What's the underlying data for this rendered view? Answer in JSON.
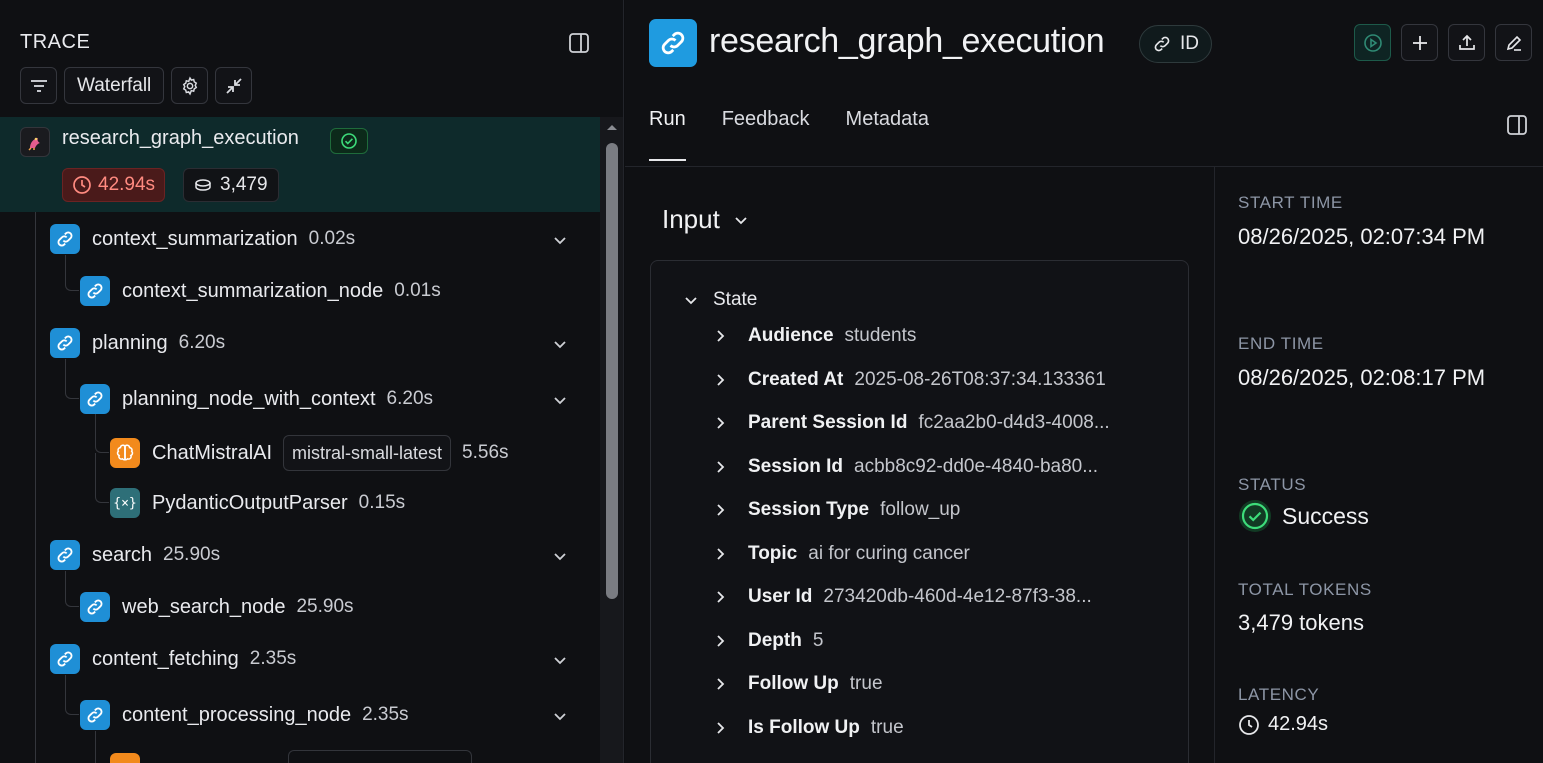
{
  "left": {
    "title": "TRACE",
    "toolbar": {
      "view_label": "Waterfall"
    },
    "root": {
      "name": "research_graph_execution",
      "latency": "42.94s",
      "tokens": "3,479"
    },
    "nodes": [
      {
        "name": "context_summarization",
        "time": "0.02s",
        "icon": "link-icon"
      },
      {
        "name": "context_summarization_node",
        "time": "0.01s",
        "icon": "link-icon"
      },
      {
        "name": "planning",
        "time": "6.20s",
        "icon": "link-icon"
      },
      {
        "name": "planning_node_with_context",
        "time": "6.20s",
        "icon": "link-icon"
      },
      {
        "name": "ChatMistralAI",
        "model": "mistral-small-latest",
        "time": "5.56s",
        "icon": "brain-icon"
      },
      {
        "name": "PydanticOutputParser",
        "time": "0.15s",
        "icon": "braces-icon"
      },
      {
        "name": "search",
        "time": "25.90s",
        "icon": "link-icon"
      },
      {
        "name": "web_search_node",
        "time": "25.90s",
        "icon": "link-icon"
      },
      {
        "name": "content_fetching",
        "time": "2.35s",
        "icon": "link-icon"
      },
      {
        "name": "content_processing_node",
        "time": "2.35s",
        "icon": "link-icon"
      }
    ]
  },
  "right": {
    "title": "research_graph_execution",
    "id_label": "ID",
    "tabs": [
      "Run",
      "Feedback",
      "Metadata"
    ],
    "input": {
      "heading": "Input",
      "state_label": "State",
      "properties": [
        {
          "key": "Audience",
          "value": "students"
        },
        {
          "key": "Created At",
          "value": "2025-08-26T08:37:34.133361"
        },
        {
          "key": "Parent Session Id",
          "value": "fc2aa2b0-d4d3-4008..."
        },
        {
          "key": "Session Id",
          "value": "acbb8c92-dd0e-4840-ba80..."
        },
        {
          "key": "Session Type",
          "value": "follow_up"
        },
        {
          "key": "Topic",
          "value": "ai for curing cancer"
        },
        {
          "key": "User Id",
          "value": "273420db-460d-4e12-87f3-38..."
        },
        {
          "key": "Depth",
          "value": "5"
        },
        {
          "key": "Follow Up",
          "value": "true"
        },
        {
          "key": "Is Follow Up",
          "value": "true"
        }
      ]
    },
    "meta": {
      "start_label": "START TIME",
      "start_value": "08/26/2025, 02:07:34 PM",
      "end_label": "END TIME",
      "end_value": "08/26/2025, 02:08:17 PM",
      "status_label": "STATUS",
      "status_value": "Success",
      "tokens_label": "TOTAL TOKENS",
      "tokens_value": "3,479 tokens",
      "latency_label": "LATENCY",
      "latency_value": "42.94s"
    }
  },
  "colors": {
    "accent_blue": "#1f9be0",
    "success_green": "#22c55e",
    "latency_red": "#ff8a80",
    "llm_orange": "#f28a1c"
  }
}
